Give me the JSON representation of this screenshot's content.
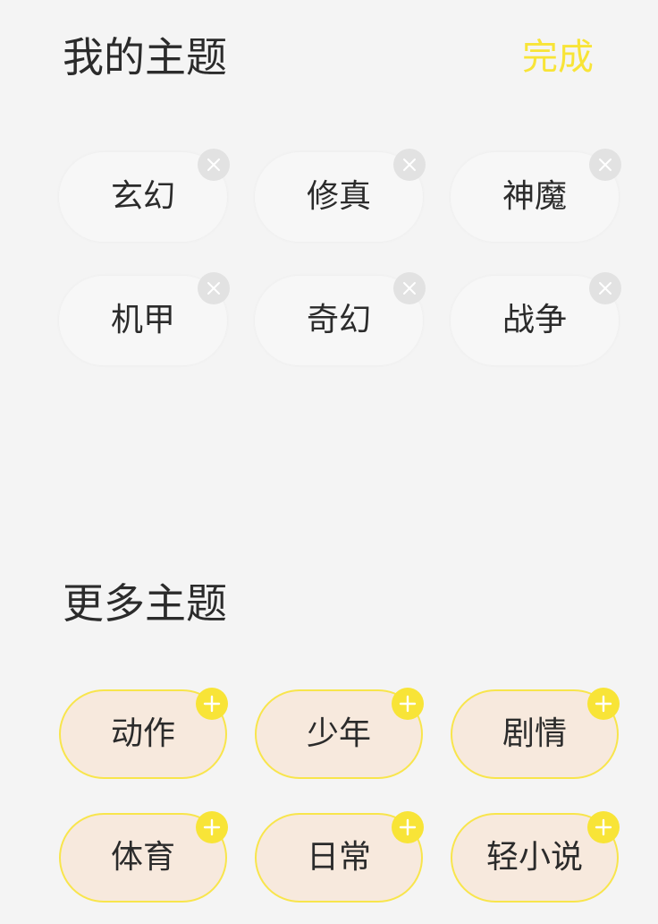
{
  "my_topics": {
    "title": "我的主题",
    "done_label": "完成",
    "items": [
      {
        "label": "玄幻"
      },
      {
        "label": "修真"
      },
      {
        "label": "神魔"
      },
      {
        "label": "机甲"
      },
      {
        "label": "奇幻"
      },
      {
        "label": "战争"
      }
    ]
  },
  "more_topics": {
    "title": "更多主题",
    "items": [
      {
        "label": "动作"
      },
      {
        "label": "少年"
      },
      {
        "label": "剧情"
      },
      {
        "label": "体育"
      },
      {
        "label": "日常"
      },
      {
        "label": "轻小说"
      }
    ]
  },
  "colors": {
    "accent": "#f8e437",
    "background": "#f4f4f4",
    "more_chip_fill": "#f7e9dd",
    "remove_badge": "#e2e2e2"
  },
  "icons": {
    "remove": "close-icon",
    "add": "plus-icon"
  }
}
